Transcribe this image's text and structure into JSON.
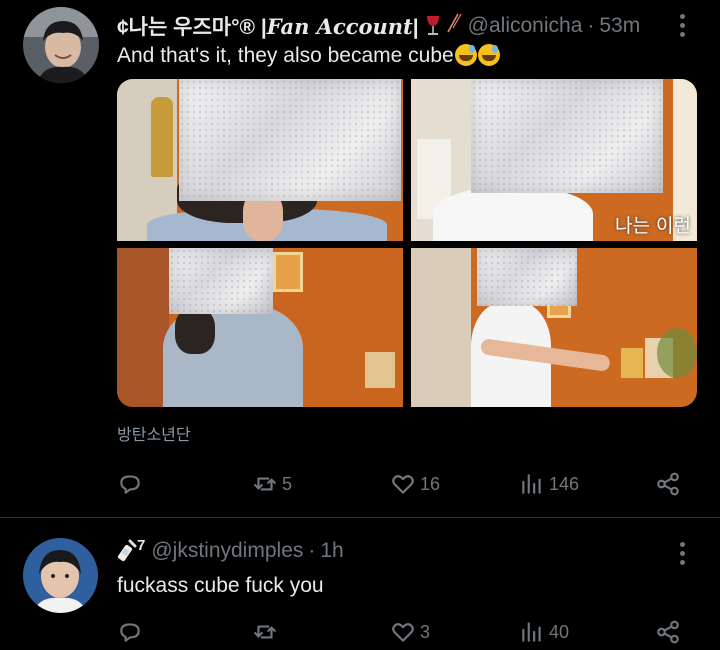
{
  "tweets": [
    {
      "display_name_main": "¢나는 우즈마°® |",
      "display_name_fan": "Fan Account",
      "display_name_end": "|",
      "handle": "@aliconicha",
      "time": "53m",
      "text": "And that's it, they also became cube",
      "emojis": [
        "sweat-smile-emoji",
        "sweat-smile-emoji"
      ],
      "media_caption": "나는 이런",
      "tag": "방탄소년단",
      "stats": {
        "reply": "",
        "retweet": "5",
        "like": "16",
        "views": "146"
      }
    },
    {
      "display_name_main": "7",
      "handle": "@jkstinydimples",
      "time": "1h",
      "text": "fuckass cube fuck you",
      "stats": {
        "reply": "",
        "retweet": "",
        "like": "3",
        "views": "40"
      }
    }
  ],
  "colors": {
    "background": "#000000",
    "text_primary": "#e7e9ea",
    "text_secondary": "#71767b",
    "divider": "#2f3336",
    "image_orange": "#c9651f"
  },
  "icons": [
    "more-icon",
    "reply-icon",
    "retweet-icon",
    "like-icon",
    "views-icon",
    "share-icon",
    "wine-glass-icon",
    "baby-bottle-icon"
  ]
}
